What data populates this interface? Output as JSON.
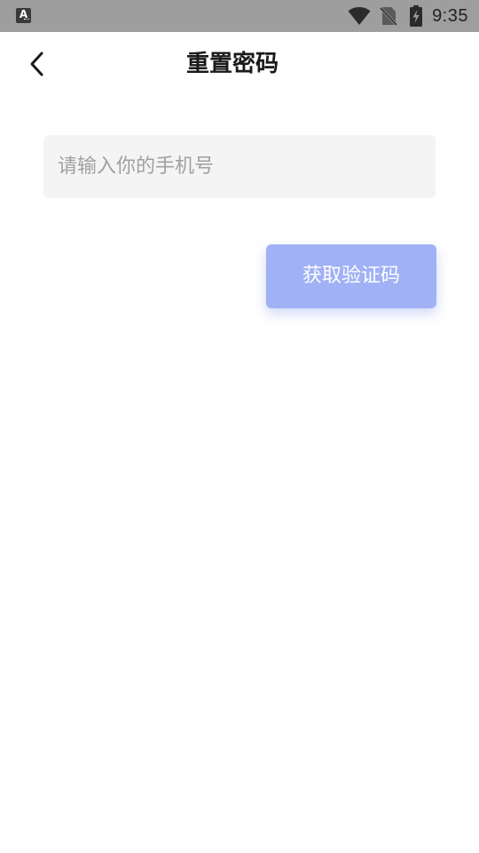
{
  "status_bar": {
    "app_icon_letter": "A",
    "time": "9:35",
    "icons": [
      "wifi-icon",
      "no-sim-icon",
      "battery-charging-icon"
    ]
  },
  "header": {
    "back_icon": "chevron-left-icon",
    "title": "重置密码"
  },
  "form": {
    "phone_input": {
      "value": "",
      "placeholder": "请输入你的手机号"
    },
    "get_code_label": "获取验证码"
  },
  "colors": {
    "status_bar_bg": "#9e9e9e",
    "input_bg": "#f4f4f4",
    "button_bg": "#a0b1f5",
    "title_text": "#1a1a1a",
    "placeholder_text": "#a0a0a0"
  }
}
